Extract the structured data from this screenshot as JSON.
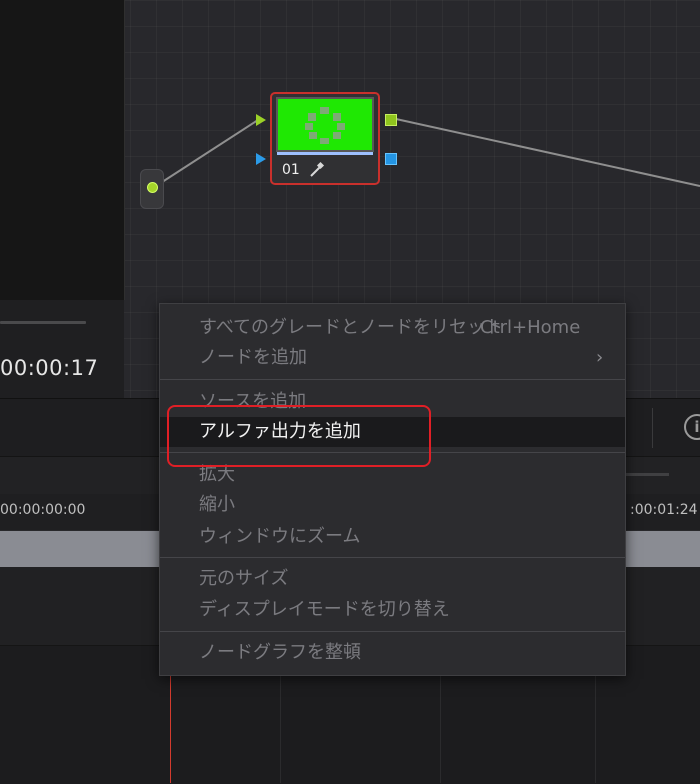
{
  "viewer": {
    "timecode": "00:00:17"
  },
  "node_graph": {
    "node": {
      "label": "01",
      "thumbnail_color": "#1fe803",
      "selected_border_color": "#c9302c",
      "eyedropper_icon": "eyedropper-icon"
    },
    "ports": {
      "rgb_color": "#9bd128",
      "alpha_color": "#2b9be8"
    }
  },
  "timeline": {
    "start_timecode": "00:00:00:00",
    "end_timecode": ":00:01:24"
  },
  "toolbar": {
    "info_icon": "info-icon",
    "info_glyph": "i"
  },
  "context_menu": {
    "groups": [
      [
        {
          "label": "すべてのグレードとノードをリセット",
          "shortcut": "Ctrl+Home"
        },
        {
          "label": "ノードを追加",
          "submenu_glyph": "›"
        }
      ],
      [
        {
          "label": "ソースを追加"
        },
        {
          "label": "アルファ出力を追加",
          "active": true
        }
      ],
      [
        {
          "label": "拡大"
        },
        {
          "label": "縮小"
        },
        {
          "label": "ウィンドウにズーム"
        }
      ],
      [
        {
          "label": "元のサイズ"
        },
        {
          "label": "ディスプレイモードを切り替え"
        }
      ],
      [
        {
          "label": "ノードグラフを整頓"
        }
      ]
    ],
    "highlight_color": "#e01f26"
  }
}
